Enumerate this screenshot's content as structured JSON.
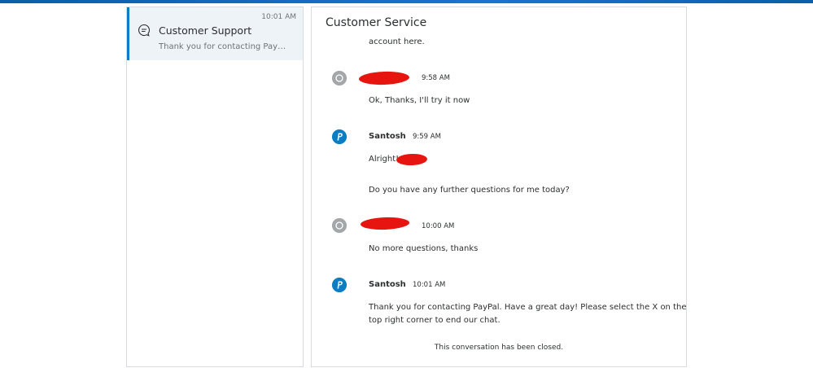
{
  "conversation_list": {
    "items": [
      {
        "title": "Customer Support",
        "time": "10:01 AM",
        "preview": "Thank you for contacting PayPal. Have a great day!",
        "icon": "chat-bubble-icon"
      }
    ]
  },
  "chat": {
    "title": "Customer Service",
    "partial_text": "account here.",
    "messages": [
      {
        "sender_type": "user",
        "sender": "",
        "time": "9:58 AM",
        "lines": [
          "Ok, Thanks, I'll try it now"
        ]
      },
      {
        "sender_type": "agent",
        "sender": "Santosh",
        "time": "9:59 AM",
        "lines": [
          "Alright!",
          "Do you have any further questions for me today?"
        ]
      },
      {
        "sender_type": "user",
        "sender": "",
        "time": "10:00 AM",
        "lines": [
          "No more questions, thanks"
        ]
      },
      {
        "sender_type": "agent",
        "sender": "Santosh",
        "time": "10:01 AM",
        "lines": [
          "Thank you for contacting PayPal. Have a great day! Please select the X on the",
          "top right corner to end our chat."
        ]
      }
    ],
    "closed_note": "This conversation has been closed."
  },
  "colors": {
    "accent": "#0c7dc3",
    "redaction": "#e6150f",
    "selected_bg": "#eef3f7"
  }
}
